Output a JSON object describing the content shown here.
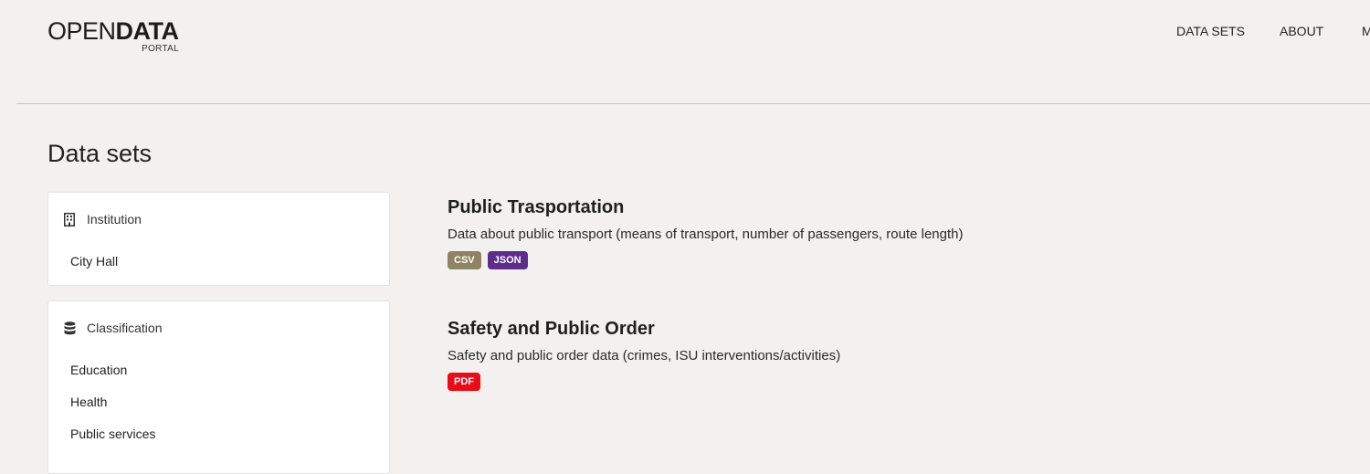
{
  "header": {
    "logo_open": "OPEN",
    "logo_data": "DATA",
    "logo_portal": "PORTAL",
    "nav": [
      "DATA SETS",
      "ABOUT",
      "M"
    ]
  },
  "page": {
    "title": "Data sets"
  },
  "sidebar": {
    "institution": {
      "title": "Institution",
      "icon": "building-icon",
      "items": [
        "City Hall"
      ]
    },
    "classification": {
      "title": "Classification",
      "icon": "database-icon",
      "items": [
        "Education",
        "Health",
        "Public services"
      ]
    }
  },
  "datasets": [
    {
      "title": "Public Trasportation",
      "description": "Data about public transport (means of transport, number of passengers, route length)",
      "formats": [
        {
          "label": "CSV",
          "color": "#8f8461"
        },
        {
          "label": "JSON",
          "color": "#5d2d8a"
        }
      ]
    },
    {
      "title": "Safety and Public Order",
      "description": "Safety and public order data (crimes, ISU interventions/activities)",
      "formats": [
        {
          "label": "PDF",
          "color": "#ea0b16"
        }
      ]
    }
  ]
}
